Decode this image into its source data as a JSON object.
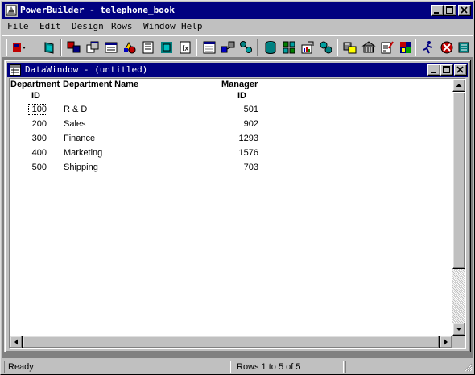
{
  "app": {
    "title": "PowerBuilder - telephone_book"
  },
  "menu": {
    "items": [
      "File",
      "Edit",
      "Design",
      "Rows",
      "Window",
      "Help"
    ]
  },
  "toolbar": {
    "buttons": [
      "new-dropdown-icon",
      "exit-icon",
      "application-icon",
      "window-painter-icon",
      "menu-painter-icon",
      "structure-icon",
      "user-object-icon",
      "function-icon",
      "datawindow-icon",
      "query-icon",
      "pipeline-icon",
      "database-icon",
      "database-profile-icon",
      "data-manipulation-icon",
      "library-icon",
      "object-browser-icon",
      "project-icon",
      "preferences-icon",
      "help-icon",
      "run-icon",
      "debug-icon",
      "exit-app-icon"
    ]
  },
  "datawindow": {
    "title": "DataWindow - (untitled)",
    "headers": {
      "dept_id_line1": "Department",
      "dept_id_line2": "ID",
      "dept_name": "Department Name",
      "manager_line1": "Manager",
      "manager_line2": "ID"
    },
    "rows": [
      {
        "dept_id": "100",
        "dept_name": "R & D",
        "manager_id": "501"
      },
      {
        "dept_id": "200",
        "dept_name": "Sales",
        "manager_id": "902"
      },
      {
        "dept_id": "300",
        "dept_name": "Finance",
        "manager_id": "1293"
      },
      {
        "dept_id": "400",
        "dept_name": "Marketing",
        "manager_id": "1576"
      },
      {
        "dept_id": "500",
        "dept_name": "Shipping",
        "manager_id": "703"
      }
    ]
  },
  "status": {
    "message": "Ready",
    "rows_info": "Rows 1 to 5 of 5"
  },
  "colors": {
    "title_bar": "#000080",
    "face": "#c0c0c0",
    "mdi_background": "#808080"
  }
}
